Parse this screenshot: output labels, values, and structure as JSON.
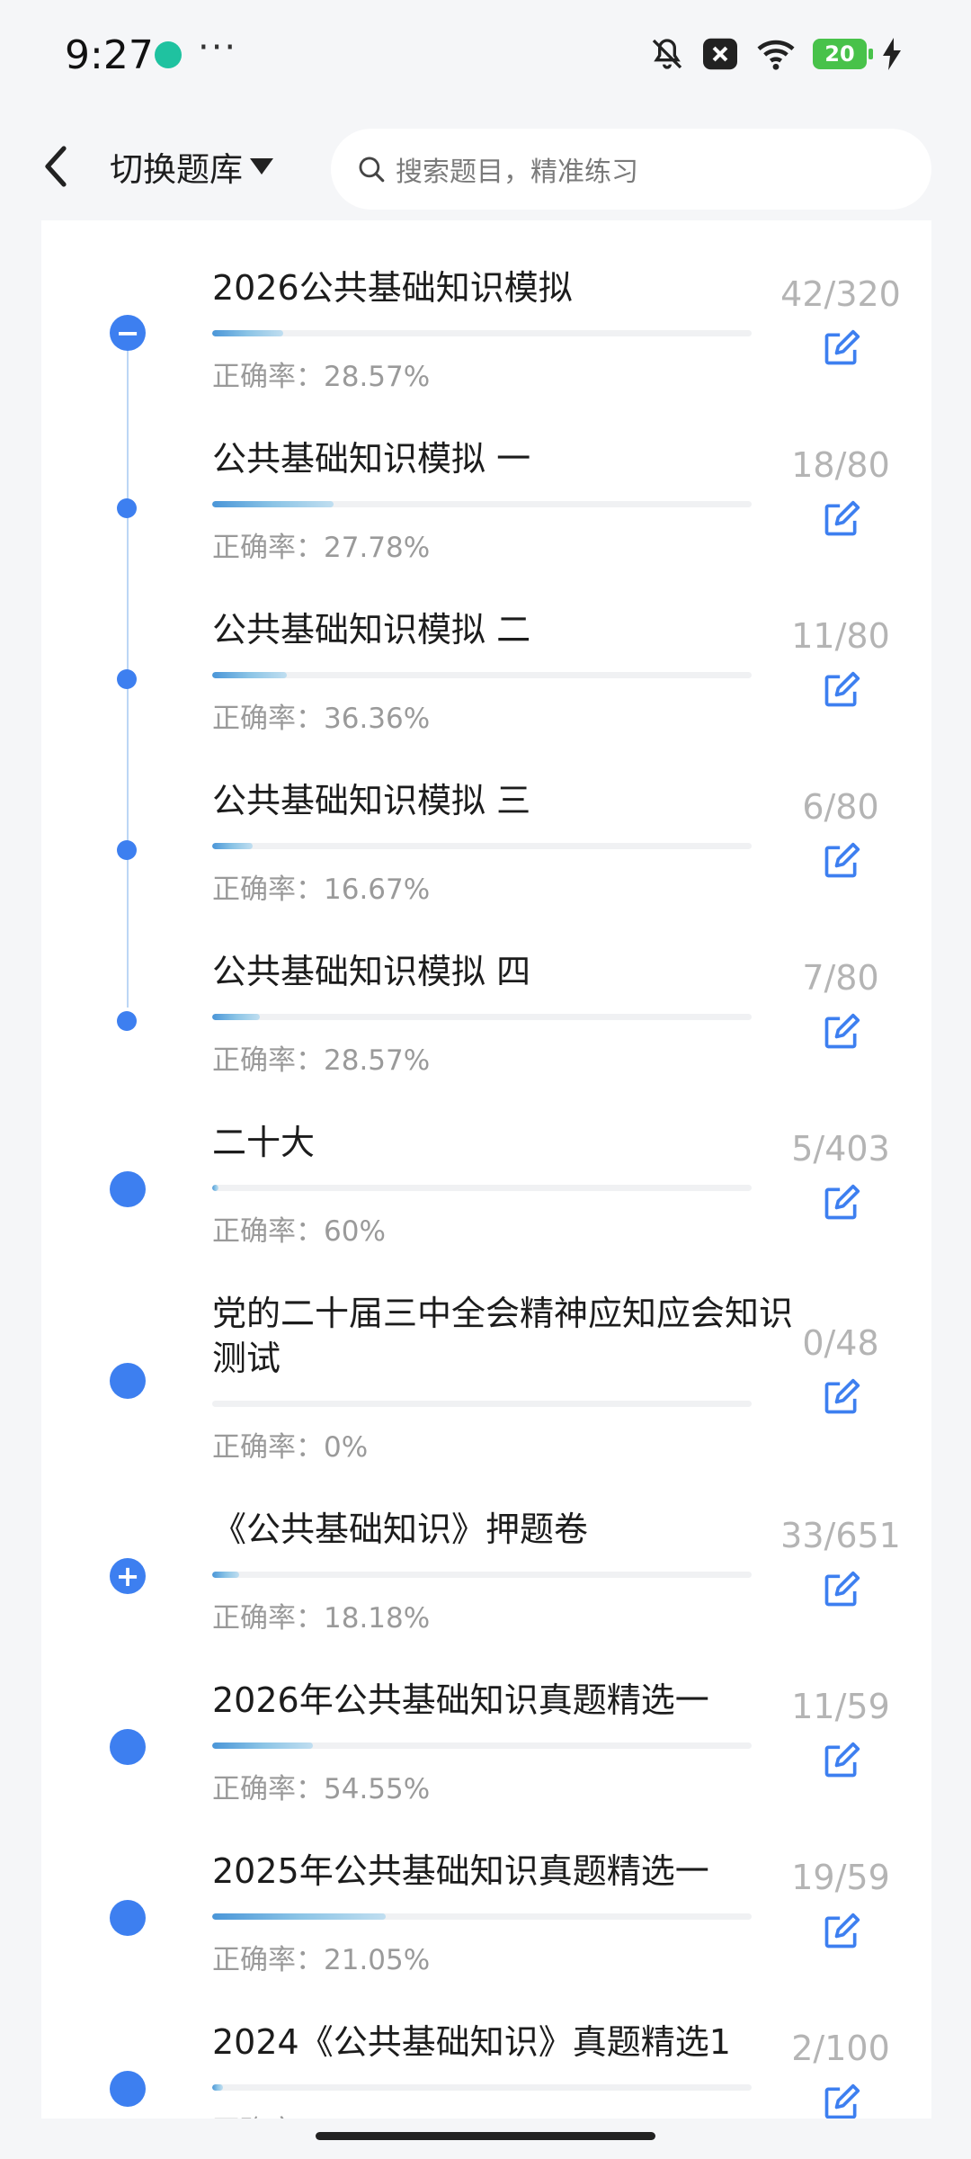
{
  "status_bar": {
    "time": "9:27",
    "more_dots": "···",
    "battery_level": "20",
    "icons": [
      "app-notification-icon",
      "mute-bell-icon",
      "close-box-icon",
      "wifi-icon",
      "battery-icon",
      "charging-bolt-icon"
    ]
  },
  "header": {
    "switch_label": "切换题库",
    "search_placeholder": "搜索题目，精准练习"
  },
  "list_items": [
    {
      "title": "2026公共基础知识模拟",
      "rate": "正确率：28.57%",
      "count": "42/320",
      "progress": 0.131,
      "node": "collapse"
    },
    {
      "title": "公共基础知识模拟 一",
      "rate": "正确率：27.78%",
      "count": "18/80",
      "progress": 0.225,
      "node": "child"
    },
    {
      "title": "公共基础知识模拟 二",
      "rate": "正确率：36.36%",
      "count": "11/80",
      "progress": 0.1375,
      "node": "child"
    },
    {
      "title": "公共基础知识模拟 三",
      "rate": "正确率：16.67%",
      "count": "6/80",
      "progress": 0.075,
      "node": "child"
    },
    {
      "title": "公共基础知识模拟 四",
      "rate": "正确率：28.57%",
      "count": "7/80",
      "progress": 0.0875,
      "node": "child"
    },
    {
      "title": "二十大",
      "rate": "正确率：60%",
      "count": "5/403",
      "progress": 0.012,
      "node": "dot"
    },
    {
      "title": "党的二十届三中全会精神应知应会知识测试",
      "rate": "正确率：0%",
      "count": "0/48",
      "progress": 0,
      "node": "dot"
    },
    {
      "title": "《公共基础知识》押题卷",
      "rate": "正确率：18.18%",
      "count": "33/651",
      "progress": 0.05,
      "node": "expand"
    },
    {
      "title": "2026年公共基础知识真题精选一",
      "rate": "正确率：54.55%",
      "count": "11/59",
      "progress": 0.186,
      "node": "dot"
    },
    {
      "title": "2025年公共基础知识真题精选一",
      "rate": "正确率：21.05%",
      "count": "19/59",
      "progress": 0.322,
      "node": "dot"
    },
    {
      "title": "2024《公共基础知识》真题精选1",
      "rate": "正确率：",
      "count": "2/100",
      "progress": 0.02,
      "node": "dot"
    }
  ],
  "colors": {
    "accent": "#3d7ff0",
    "timeline": "#bcd6f5",
    "count_text": "#b4b4b4",
    "rate_text": "#9a9a9a"
  }
}
